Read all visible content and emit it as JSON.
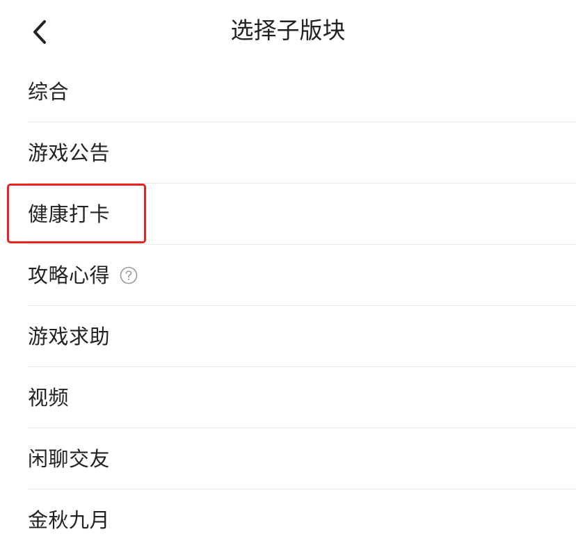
{
  "header": {
    "title": "选择子版块",
    "back_icon": "chevron-left-icon"
  },
  "sections": [
    {
      "label": "综合"
    },
    {
      "label": "游戏公告"
    },
    {
      "label": "健康打卡"
    },
    {
      "label": "攻略心得",
      "has_help": true
    },
    {
      "label": "游戏求助"
    },
    {
      "label": "视频"
    },
    {
      "label": "闲聊交友"
    },
    {
      "label": "金秋九月"
    }
  ],
  "colors": {
    "highlight": "#e8231f",
    "divider": "#ececec",
    "text": "#222222",
    "help_icon": "#999999"
  }
}
